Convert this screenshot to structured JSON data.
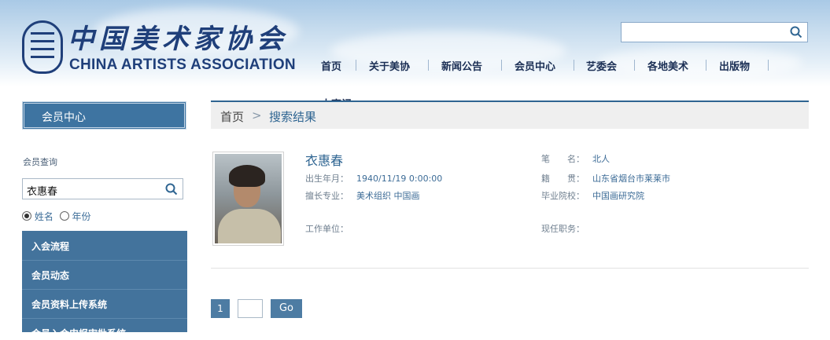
{
  "header": {
    "logo_cn": "中国美术家协会",
    "logo_en": "CHINA ARTISTS ASSOCIATION",
    "search_value": ""
  },
  "nav": {
    "items": [
      "首页",
      "关于美协",
      "新闻公告",
      "会员中心",
      "艺委会",
      "各地美术",
      "出版物"
    ],
    "extra": "大事记"
  },
  "sidebar": {
    "title": "会员中心",
    "query_label": "会员查询",
    "query_value": "衣惠春",
    "radio_name": "姓名",
    "radio_year": "年份",
    "menu": [
      "入会流程",
      "会员动态",
      "会员资料上传系统",
      "会员入会申报审批系统"
    ]
  },
  "breadcrumb": {
    "home": "首页",
    "arrow": ">",
    "current": "搜索结果"
  },
  "result": {
    "name": "衣惠春",
    "birth_label": "出生年月：",
    "birth_value": "1940/11/19 0:00:00",
    "specialty_label": "擅长专业：",
    "specialty_value": "美术组织  中国画",
    "work_label": "工作单位：",
    "work_value": "",
    "pen_label": "笔　　名：",
    "pen_value": "北人",
    "origin_label": "籍　　贯：",
    "origin_value": "山东省烟台市莱莱市",
    "school_label": "毕业院校：",
    "school_value": "中国画研究院",
    "title_label": "现任职务：",
    "title_value": ""
  },
  "pagination": {
    "current_page": "1",
    "input_value": "",
    "go_label": "Go"
  },
  "colors": {
    "brand": "#1f3f7a",
    "accent": "#43739c"
  }
}
